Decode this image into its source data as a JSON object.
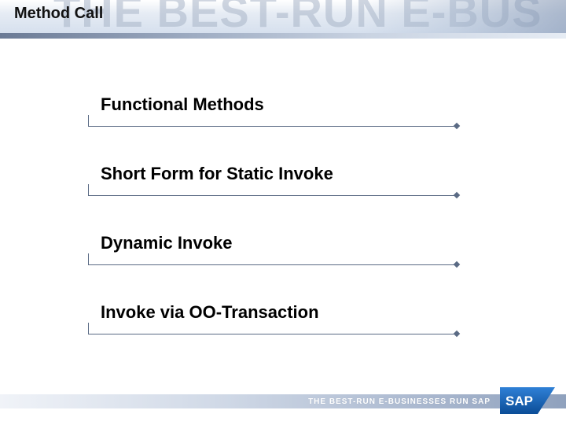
{
  "header": {
    "ghost_text": "THE BEST-RUN E-BUS",
    "title": "Method Call"
  },
  "items": [
    {
      "label": "Functional Methods"
    },
    {
      "label": "Short Form for Static Invoke"
    },
    {
      "label": "Dynamic Invoke"
    },
    {
      "label": "Invoke via OO-Transaction"
    }
  ],
  "footer": {
    "tagline": "THE BEST-RUN E-BUSINESSES RUN SAP",
    "logo_text": "SAP"
  },
  "colors": {
    "line": "#5a6a84",
    "sap_blue": "#1b63b0"
  }
}
